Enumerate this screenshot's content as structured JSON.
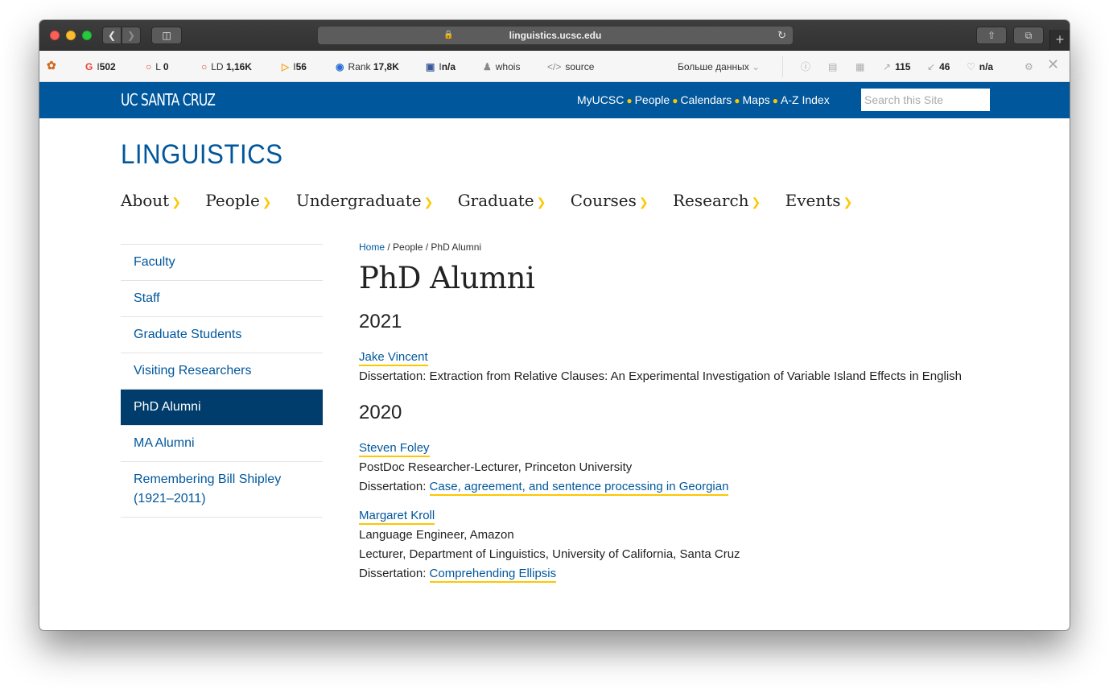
{
  "browser": {
    "url": "linguistics.ucsc.edu"
  },
  "extensions": {
    "google": {
      "label": "I",
      "value": "502"
    },
    "links": {
      "label": "L",
      "value": "0"
    },
    "ld": {
      "label": "LD",
      "value": "1,16K"
    },
    "bing": {
      "label": "I",
      "value": "56"
    },
    "rank": {
      "label": "Rank",
      "value": "17,8K"
    },
    "facebook": {
      "label": "I",
      "value": "n/a"
    },
    "whois": "whois",
    "source": "source",
    "more": "Больше данных",
    "external": "115",
    "internal": "46",
    "heart": "n/a"
  },
  "header": {
    "logo": "UC SANTA CRUZ",
    "links": [
      "MyUCSC",
      "People",
      "Calendars",
      "Maps",
      "A-Z Index"
    ],
    "search_placeholder": "Search this Site"
  },
  "site_title": "LINGUISTICS",
  "main_nav": [
    "About",
    "People",
    "Undergraduate",
    "Graduate",
    "Courses",
    "Research",
    "Events"
  ],
  "side_nav": [
    "Faculty",
    "Staff",
    "Graduate Students",
    "Visiting Researchers",
    "PhD Alumni",
    "MA Alumni",
    "Remembering Bill Shipley (1921–2011)"
  ],
  "breadcrumb": {
    "home": "Home",
    "rest": " / People / PhD Alumni"
  },
  "page_title": "PhD Alumni",
  "years": [
    {
      "year": "2021",
      "alumni": [
        {
          "name": "Jake Vincent",
          "diss_label": "Dissertation: ",
          "diss_text": "Extraction from Relative Clauses: An Experimental Investigation of Variable Island Effects in English"
        }
      ]
    },
    {
      "year": "2020",
      "alumni": [
        {
          "name": "Steven Foley",
          "position": "PostDoc Researcher-Lecturer, Princeton University",
          "diss_label": "Dissertation: ",
          "diss_link": "Case, agreement, and sentence processing in Georgian"
        },
        {
          "name": "Margaret Kroll",
          "position": "Language Engineer, Amazon",
          "position2": "Lecturer, Department of Linguistics, University of California, Santa Cruz",
          "diss_label": "Dissertation: ",
          "diss_link": "Comprehending Ellipsis"
        }
      ]
    }
  ]
}
